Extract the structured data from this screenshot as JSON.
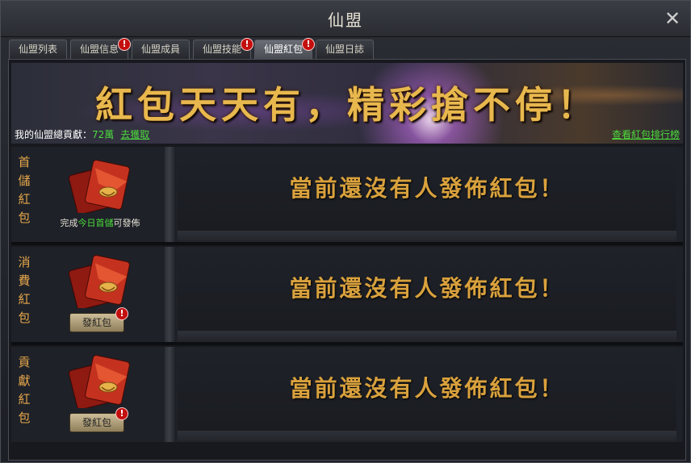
{
  "window": {
    "title": "仙盟",
    "close_label": "✕"
  },
  "tabs": [
    {
      "label": "仙盟列表",
      "badge": ""
    },
    {
      "label": "仙盟信息",
      "badge": "!"
    },
    {
      "label": "仙盟成員",
      "badge": ""
    },
    {
      "label": "仙盟技能",
      "badge": "!"
    },
    {
      "label": "仙盟紅包",
      "badge": "!"
    },
    {
      "label": "仙盟日誌",
      "badge": ""
    }
  ],
  "active_tab": "仙盟紅包",
  "banner": {
    "slogan": "紅包天天有，精彩搶不停！",
    "contrib_label": "我的仙盟總貢獻：",
    "contrib_value": "72萬",
    "earn_link": "去獲取",
    "rank_link": "查看紅包排行榜"
  },
  "rows": [
    {
      "label": "首儲紅包",
      "caption_prefix": "完成",
      "caption_highlight": "今日首儲",
      "caption_suffix": "可發佈",
      "button": "",
      "message": "當前還沒有人發佈紅包！"
    },
    {
      "label": "消費紅包",
      "button": "發紅包",
      "badge": "!",
      "message": "當前還沒有人發佈紅包！"
    },
    {
      "label": "貢獻紅包",
      "button": "發紅包",
      "badge": "!",
      "message": "當前還沒有人發佈紅包！"
    }
  ],
  "colors": {
    "accent_gold": "#e6a74a",
    "link_green": "#4cdc3c",
    "badge_red": "#c40f0f"
  },
  "icons": [
    "close-icon",
    "red-envelope-icon",
    "alert-badge-icon"
  ]
}
